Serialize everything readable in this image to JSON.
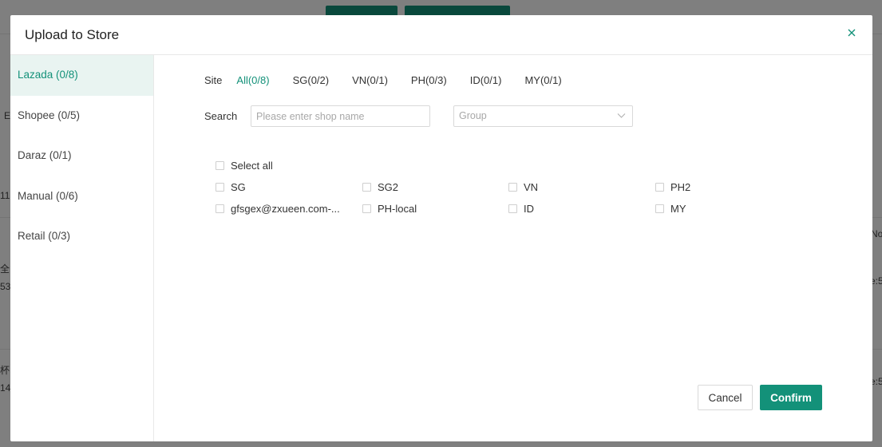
{
  "background": {
    "fragments": [
      "E",
      "11",
      "No",
      "全",
      "53",
      "e:5",
      "杯",
      "14",
      "e:5"
    ]
  },
  "modal": {
    "title": "Upload to Store",
    "close_icon": "close-icon"
  },
  "sidebar": {
    "items": [
      {
        "label": "Lazada (0/8)",
        "active": true
      },
      {
        "label": "Shopee (0/5)",
        "active": false
      },
      {
        "label": "Daraz (0/1)",
        "active": false
      },
      {
        "label": "Manual (0/6)",
        "active": false
      },
      {
        "label": "Retail (0/3)",
        "active": false
      }
    ]
  },
  "site": {
    "label": "Site",
    "tabs": [
      {
        "label": "All(0/8)",
        "active": true
      },
      {
        "label": "SG(0/2)",
        "active": false
      },
      {
        "label": "VN(0/1)",
        "active": false
      },
      {
        "label": "PH(0/3)",
        "active": false
      },
      {
        "label": "ID(0/1)",
        "active": false
      },
      {
        "label": "MY(0/1)",
        "active": false
      }
    ]
  },
  "search": {
    "label": "Search",
    "placeholder": "Please enter shop name",
    "value": ""
  },
  "group": {
    "placeholder": "Group"
  },
  "shops": {
    "select_all": "Select all",
    "items": [
      "SG",
      "SG2",
      "VN",
      "PH2",
      "gfsgex@zxueen.com-...",
      "PH-local",
      "ID",
      "MY"
    ]
  },
  "footer": {
    "cancel_label": "Cancel",
    "confirm_label": "Confirm"
  },
  "colors": {
    "accent": "#139179",
    "active_bg": "#e9f4f1"
  }
}
